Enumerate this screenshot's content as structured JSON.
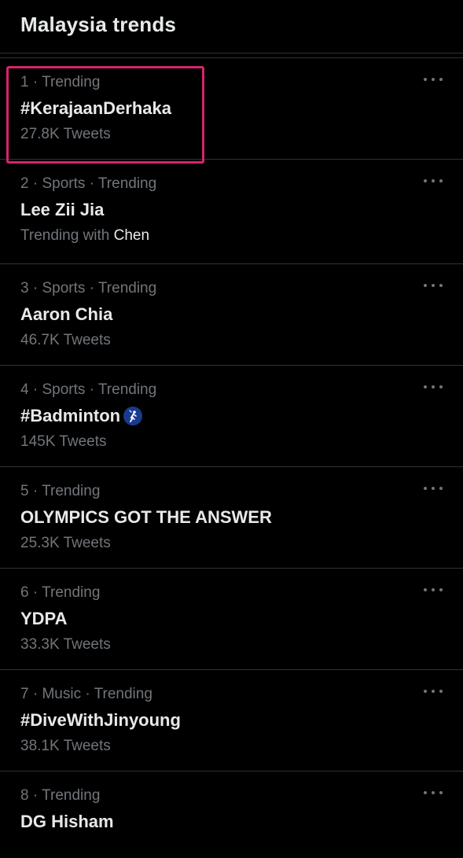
{
  "header": {
    "title": "Malaysia trends"
  },
  "trends": [
    {
      "meta": "1 · Trending",
      "name": "#KerajaanDerhaka",
      "sub": "27.8K Tweets"
    },
    {
      "meta": "2 · Sports · Trending",
      "name": "Lee Zii Jia",
      "sub_prefix": "Trending with ",
      "sub_highlight": "Chen"
    },
    {
      "meta": "3 · Sports · Trending",
      "name": "Aaron Chia",
      "sub": "46.7K Tweets"
    },
    {
      "meta": "4 · Sports · Trending",
      "name": "#Badminton",
      "sub": "145K Tweets",
      "icon": "badminton-emoji-icon"
    },
    {
      "meta": "5 · Trending",
      "name": "OLYMPICS GOT THE ANSWER",
      "sub": "25.3K Tweets"
    },
    {
      "meta": "6 · Trending",
      "name": "YDPA",
      "sub": "33.3K Tweets"
    },
    {
      "meta": "7 · Music · Trending",
      "name": "#DiveWithJinyoung",
      "sub": "38.1K Tweets"
    },
    {
      "meta": "8 · Trending",
      "name": "DG Hisham"
    }
  ],
  "colors": {
    "background": "#000000",
    "primary_text": "#e7e9ea",
    "secondary_text": "#71767b",
    "divider": "#2f3336",
    "highlight_border": "#d6246e"
  },
  "icons": {
    "more": "more-dots-icon"
  }
}
